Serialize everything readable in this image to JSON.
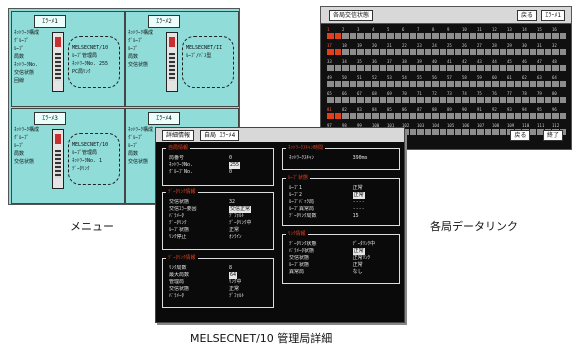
{
  "captions": {
    "menu": "メニュー",
    "link": "各局データリンク",
    "detail": "MELSECNET/10 管理局詳細"
  },
  "menu_screen": {
    "quadrants": [
      {
        "tab": "ｴﾗｰﾒ1",
        "labels": [
          "ﾈｯﾄﾜｰｸ構成",
          "ｸﾞﾙｰﾌﾟ",
          "ﾙｰﾌﾟ",
          "局数",
          "ﾈｯﾄﾜｰｸNo.",
          "交信状態",
          "回線",
          "",
          "",
          "",
          ""
        ],
        "ring_text": [
          "MELSECNET/10",
          "ﾙｰﾌﾟ管理局",
          "ﾈｯﾄﾜｰｸNo. 255",
          "PC局ﾘﾝｸ"
        ]
      },
      {
        "tab": "ｴﾗｰﾒ2",
        "labels": [
          "ﾈｯﾄﾜｰｸ構成",
          "ｸﾞﾙｰﾌﾟ",
          "ﾙｰﾌﾟ",
          "局数",
          "交信状態",
          "",
          "",
          "",
          "",
          "",
          ""
        ],
        "ring_text": [
          "MELSECNET/II",
          "ﾙｰﾌﾟ/ﾊﾞｽ型"
        ]
      },
      {
        "tab": "ｴﾗｰﾒ3",
        "labels": [
          "ﾈｯﾄﾜｰｸ構成",
          "ｸﾞﾙｰﾌﾟ",
          "ﾙｰﾌﾟ",
          "局数",
          "交信状態",
          "",
          "",
          "",
          "",
          "",
          ""
        ],
        "ring_text": [
          "MELSECNET/10",
          "ﾙｰﾌﾟ管理局",
          "ﾈｯﾄﾜｰｸNo.  1",
          "ﾃﾞｰﾀﾘﾝｸ"
        ]
      },
      {
        "tab": "ｴﾗｰﾒ4",
        "labels": [
          "ﾈｯﾄﾜｰｸ構成",
          "ｸﾞﾙｰﾌﾟ",
          "ﾙｰﾌﾟ",
          "局数",
          "交信状態",
          "",
          "",
          "",
          "",
          "",
          ""
        ],
        "ring_text": []
      }
    ]
  },
  "link_screen": {
    "title": "各局交信状態",
    "tab": "ｴﾗｰﾒ1",
    "buttons": [
      "戻る",
      "ｴﾗｰﾒ1"
    ],
    "footer_buttons": [
      "戻る",
      "終了"
    ],
    "stations": [
      {
        "n": "1",
        "err": true
      },
      {
        "n": "2",
        "err": false
      },
      {
        "n": "3",
        "err": false
      },
      {
        "n": "4",
        "err": false
      },
      {
        "n": "5",
        "err": false
      },
      {
        "n": "6",
        "err": false
      },
      {
        "n": "7",
        "err": false
      },
      {
        "n": "8",
        "err": false
      },
      {
        "n": "9",
        "err": false
      },
      {
        "n": "10",
        "err": false
      },
      {
        "n": "11",
        "err": false
      },
      {
        "n": "12",
        "err": false
      },
      {
        "n": "13",
        "err": false
      },
      {
        "n": "14",
        "err": false
      },
      {
        "n": "15",
        "err": false
      },
      {
        "n": "16",
        "err": false
      },
      {
        "n": "17",
        "err": true
      },
      {
        "n": "18",
        "err": false
      },
      {
        "n": "19",
        "err": false
      },
      {
        "n": "20",
        "err": false
      },
      {
        "n": "21",
        "err": false
      },
      {
        "n": "22",
        "err": false
      },
      {
        "n": "23",
        "err": false
      },
      {
        "n": "24",
        "err": false
      },
      {
        "n": "25",
        "err": false
      },
      {
        "n": "26",
        "err": false
      },
      {
        "n": "27",
        "err": false
      },
      {
        "n": "28",
        "err": false
      },
      {
        "n": "29",
        "err": false
      },
      {
        "n": "30",
        "err": false
      },
      {
        "n": "31",
        "err": false
      },
      {
        "n": "32",
        "err": false
      },
      {
        "n": "33",
        "err": false
      },
      {
        "n": "34",
        "err": false
      },
      {
        "n": "35",
        "err": false
      },
      {
        "n": "36",
        "err": false
      },
      {
        "n": "37",
        "err": false
      },
      {
        "n": "38",
        "err": false
      },
      {
        "n": "39",
        "err": false
      },
      {
        "n": "40",
        "err": false
      },
      {
        "n": "41",
        "err": false
      },
      {
        "n": "42",
        "err": false
      },
      {
        "n": "43",
        "err": false
      },
      {
        "n": "44",
        "err": false
      },
      {
        "n": "45",
        "err": false
      },
      {
        "n": "46",
        "err": false
      },
      {
        "n": "47",
        "err": false
      },
      {
        "n": "48",
        "err": false
      },
      {
        "n": "49",
        "err": false
      },
      {
        "n": "50",
        "err": false
      },
      {
        "n": "51",
        "err": false
      },
      {
        "n": "52",
        "err": false
      },
      {
        "n": "53",
        "err": false
      },
      {
        "n": "54",
        "err": false
      },
      {
        "n": "55",
        "err": false
      },
      {
        "n": "56",
        "err": false
      },
      {
        "n": "57",
        "err": false
      },
      {
        "n": "58",
        "err": false
      },
      {
        "n": "59",
        "err": false
      },
      {
        "n": "60",
        "err": false
      },
      {
        "n": "61",
        "err": false
      },
      {
        "n": "62",
        "err": false
      },
      {
        "n": "63",
        "err": false
      },
      {
        "n": "64",
        "err": false
      },
      {
        "n": "65",
        "err": false
      },
      {
        "n": "66",
        "err": false
      },
      {
        "n": "67",
        "err": false
      },
      {
        "n": "68",
        "err": false
      },
      {
        "n": "69",
        "err": false
      },
      {
        "n": "70",
        "err": false
      },
      {
        "n": "71",
        "err": false
      },
      {
        "n": "72",
        "err": false
      },
      {
        "n": "73",
        "err": false
      },
      {
        "n": "74",
        "err": false
      },
      {
        "n": "75",
        "err": false
      },
      {
        "n": "76",
        "err": false
      },
      {
        "n": "77",
        "err": false
      },
      {
        "n": "78",
        "err": false
      },
      {
        "n": "79",
        "err": false
      },
      {
        "n": "80",
        "err": false
      },
      {
        "n": "81",
        "err": true
      },
      {
        "n": "82",
        "err": false
      },
      {
        "n": "83",
        "err": false
      },
      {
        "n": "84",
        "err": false
      },
      {
        "n": "85",
        "err": false
      },
      {
        "n": "86",
        "err": false
      },
      {
        "n": "87",
        "err": false
      },
      {
        "n": "88",
        "err": false
      },
      {
        "n": "89",
        "err": false
      },
      {
        "n": "90",
        "err": false
      },
      {
        "n": "91",
        "err": false
      },
      {
        "n": "92",
        "err": false
      },
      {
        "n": "93",
        "err": false
      },
      {
        "n": "94",
        "err": false
      },
      {
        "n": "95",
        "err": false
      },
      {
        "n": "96",
        "err": false
      },
      {
        "n": "97",
        "err": false
      },
      {
        "n": "98",
        "err": false
      },
      {
        "n": "99",
        "err": false
      },
      {
        "n": "100",
        "err": false
      },
      {
        "n": "101",
        "err": false
      },
      {
        "n": "102",
        "err": false
      },
      {
        "n": "103",
        "err": false
      },
      {
        "n": "104",
        "err": false
      },
      {
        "n": "105",
        "err": false
      },
      {
        "n": "106",
        "err": false
      },
      {
        "n": "107",
        "err": false
      },
      {
        "n": "108",
        "err": false
      },
      {
        "n": "109",
        "err": false
      },
      {
        "n": "110",
        "err": false
      },
      {
        "n": "111",
        "err": false
      },
      {
        "n": "112",
        "err": false
      }
    ],
    "colors": {
      "error": "#e04020",
      "normal": "#8d8d8d"
    }
  },
  "detail_screen": {
    "title": "詳細情報",
    "tab": "自局 ｴﾗｰﾒ4",
    "panels": {
      "self": {
        "title": "自局情報",
        "rows": [
          [
            "局番号",
            "0"
          ],
          [
            "ﾈｯﾄﾜｰｸNo.",
            "255"
          ],
          [
            "ｸﾞﾙｰﾌﾟNo.",
            "0"
          ]
        ]
      },
      "network": {
        "title": "ﾈｯﾄﾜｰｸｽｷｬﾝ時間",
        "rows": [
          [
            "ﾈｯﾄﾜｰｸｽｷｬﾝ",
            "390ms"
          ]
        ]
      },
      "status": {
        "title": "ﾃﾞｰﾀﾘﾝｸ情報",
        "rows": [
          [
            "交信状態",
            "32"
          ],
          [
            "交信ｴﾗｰ要因",
            "交信正常"
          ],
          [
            "ﾊﾟﾗﾒｰﾀ",
            "ﾃﾞﾌｫﾙﾄ"
          ],
          [
            "ﾃﾞｰﾀﾘﾝｸ",
            "ﾃﾞｰﾀﾘﾝｸ中"
          ],
          [
            "ﾙｰﾌﾟ状態",
            "正常"
          ],
          [
            "ﾘﾝｸ停止",
            "ｵﾝﾗｲﾝ"
          ]
        ]
      },
      "loop": {
        "title": "ﾙｰﾌﾟ状態",
        "rows": [
          [
            "ﾙｰﾌﾟ1",
            "正常"
          ],
          [
            "ﾙｰﾌﾟ2",
            "正常"
          ],
          [
            "ﾙｰﾌﾟﾊﾞｯｸ局",
            "----"
          ],
          [
            "ﾙｰﾌﾟ異常局",
            "----"
          ],
          [
            "ﾃﾞｰﾀﾘﾝｸ局数",
            "15"
          ]
        ]
      },
      "data": {
        "title": "ﾃﾞｰﾀﾘﾝｸ情報",
        "rows": [
          [
            "ﾘﾝｸ局数",
            "8"
          ],
          [
            "最大局数",
            "64"
          ],
          [
            "管理局",
            "ﾘﾝｸ中"
          ],
          [
            "交信状態",
            "正常"
          ],
          [
            "ﾊﾟﾗﾒｰﾀ",
            "ﾃﾞﾌｫﾙﾄ"
          ]
        ]
      },
      "link": {
        "title": "ﾘﾝｸ情報",
        "rows": [
          [
            "ﾃﾞｰﾀﾘﾝｸ状態",
            "ﾃﾞｰﾀﾘﾝｸ中"
          ],
          [
            "ﾊﾟﾗﾒｰﾀ状態",
            "正常"
          ],
          [
            "交信状態",
            "正常ﾘﾝｸ"
          ],
          [
            "ﾙｰﾌﾟ状態",
            "正常"
          ],
          [
            "異常局",
            "なし"
          ]
        ]
      }
    }
  }
}
